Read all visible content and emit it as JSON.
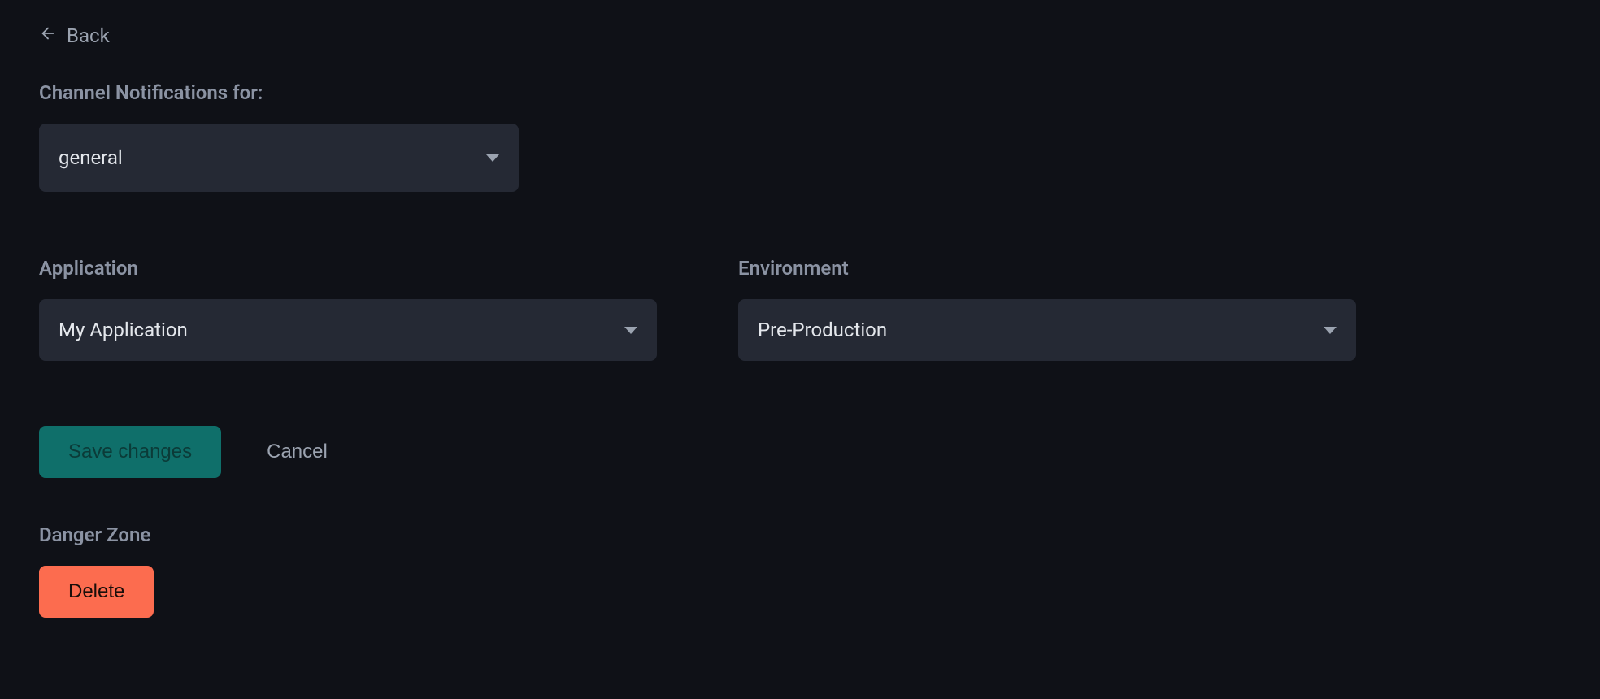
{
  "nav": {
    "back_label": "Back"
  },
  "channel": {
    "label": "Channel Notifications for:",
    "selected": "general"
  },
  "application": {
    "label": "Application",
    "selected": "My Application"
  },
  "environment": {
    "label": "Environment",
    "selected": "Pre-Production"
  },
  "actions": {
    "save_label": "Save changes",
    "cancel_label": "Cancel"
  },
  "danger": {
    "label": "Danger Zone",
    "delete_label": "Delete"
  }
}
